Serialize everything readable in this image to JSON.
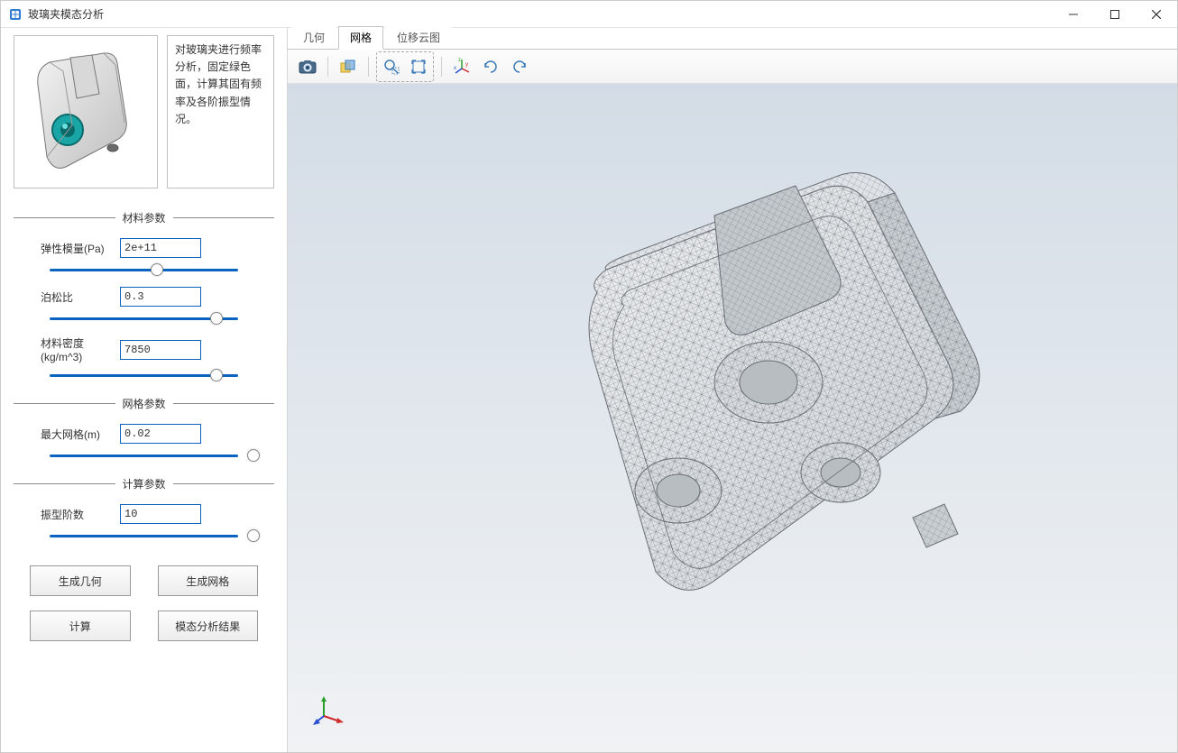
{
  "window": {
    "title": "玻璃夹模态分析"
  },
  "sidebar": {
    "description": "对玻璃夹进行频率分析，固定绿色面，计算其固有频率及各阶振型情况。",
    "sections": {
      "material": "材料参数",
      "mesh": "网格参数",
      "compute": "计算参数"
    },
    "params": {
      "young_label": "弹性模量(Pa)",
      "young_value": "2e+11",
      "poisson_label": "泊松比",
      "poisson_value": "0.3",
      "density_label": "材料密度(kg/m^3)",
      "density_value": "7850",
      "maxmesh_label": "最大网格(m)",
      "maxmesh_value": "0.02",
      "modes_label": "振型阶数",
      "modes_value": "10"
    },
    "buttons": {
      "gen_geometry": "生成几何",
      "gen_mesh": "生成网格",
      "compute": "计算",
      "results": "模态分析结果"
    }
  },
  "tabs": {
    "tab1": "几何",
    "tab2": "网格",
    "tab3": "位移云图"
  }
}
